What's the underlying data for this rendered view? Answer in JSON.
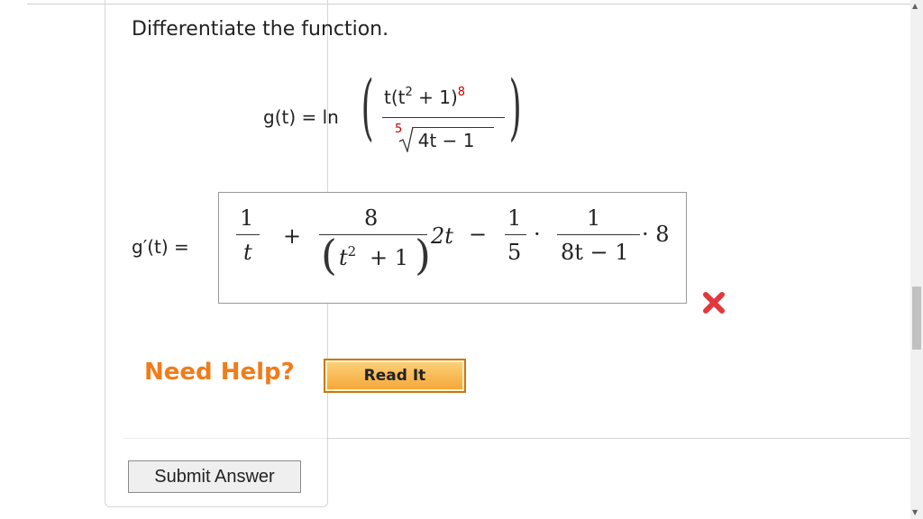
{
  "question": {
    "prompt": "Differentiate the function.",
    "function_lhs": "g(t) = ln",
    "numerator_base": "t(t",
    "numerator_sup2": "2",
    "numerator_rest": " + 1)",
    "numerator_exp": "8",
    "root_index": "5",
    "radicand": "4t − 1"
  },
  "answer": {
    "label": "g′(t) =",
    "term1_num": "1",
    "term1_den": "t",
    "plus": "+",
    "term2_num": "8",
    "term2_den_base": "t",
    "term2_den_sup": "2",
    "term2_den_rest": "+ 1",
    "term2_factor": "2t",
    "minus": "−",
    "term3_num": "1",
    "term3_den": "5",
    "dot": "·",
    "term4_num": "1",
    "term4_den": "8t − 1",
    "term4_factor": "· 8",
    "status": "incorrect"
  },
  "actions": {
    "need_help": "Need Help?",
    "read_it": "Read It",
    "submit": "Submit Answer"
  },
  "colors": {
    "accent": "#f07c1a",
    "error": "#e0393e",
    "highlight_red": "#cc0000"
  }
}
